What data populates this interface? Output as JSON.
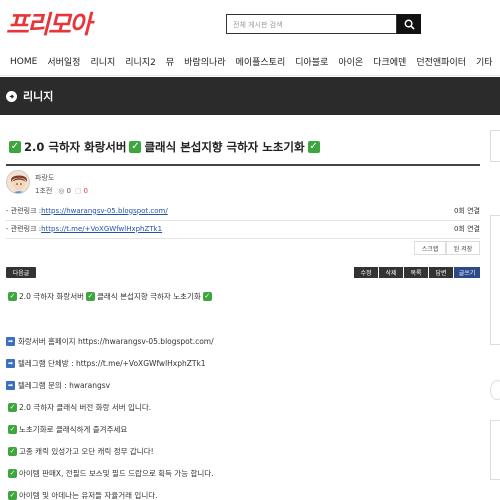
{
  "header": {
    "logo_part1": "프리",
    "logo_part2": "모아",
    "search_placeholder": "전체 게시판 검색"
  },
  "nav": {
    "items": [
      "HOME",
      "서버일정",
      "리니지",
      "리니지2",
      "뮤",
      "바람의나라",
      "메이플스토리",
      "디아블로",
      "아이온",
      "다크에덴",
      "던전앤파이터",
      "기타"
    ]
  },
  "board": {
    "name": "리니지"
  },
  "post": {
    "title_a": "2.0 극하자 화랑서버",
    "title_b": "클래식 본섭지향 극하자 노초기화",
    "author": "파랑도",
    "tier": "1초전",
    "views": "0",
    "comments": "0",
    "links": [
      {
        "prefix": "- 관련링크 : ",
        "url": "https://hwarangsv-05.blogspot.com/",
        "count": "0회 연결"
      },
      {
        "prefix": "- 관련링크 : ",
        "url": "https://t.me/+VoXGWfwlHxphZTk1",
        "count": "0회 연결"
      }
    ],
    "util_buttons": [
      "스크랩",
      "된 저장"
    ],
    "list_button": "다음글",
    "actions": [
      "수정",
      "삭제",
      "목록",
      "답변",
      "글쓰기"
    ],
    "body_lines": [
      "2.0 극하자 화랑서버",
      "클래식 본섭지향 극하자 노초기화",
      "화랑서버 홈페이지 https://hwarangsv-05.blogspot.com/",
      "텔레그램 단체방 : https://t.me/+VoXGWfwlHxphZTk1",
      "텔레그램 문의 : hwarangsv",
      "2.0 극하자 클래식 버전 화랑 서버 입니다.",
      "노초기화로 클래식하게 즐겨주세요",
      "고종 캐릭 있성가고 오단 캐릭 정무 갑니다!",
      "아이템 판매X, 전필드 보스및 필드 드랍으로 획득 가능 합니다.",
      "아이템 및 아데나는 유저들 자율거래 입니다."
    ]
  },
  "colors": {
    "brand": "#e8353a",
    "band": "#2b2b2b",
    "check": "#3da63d",
    "link": "#2255aa"
  }
}
